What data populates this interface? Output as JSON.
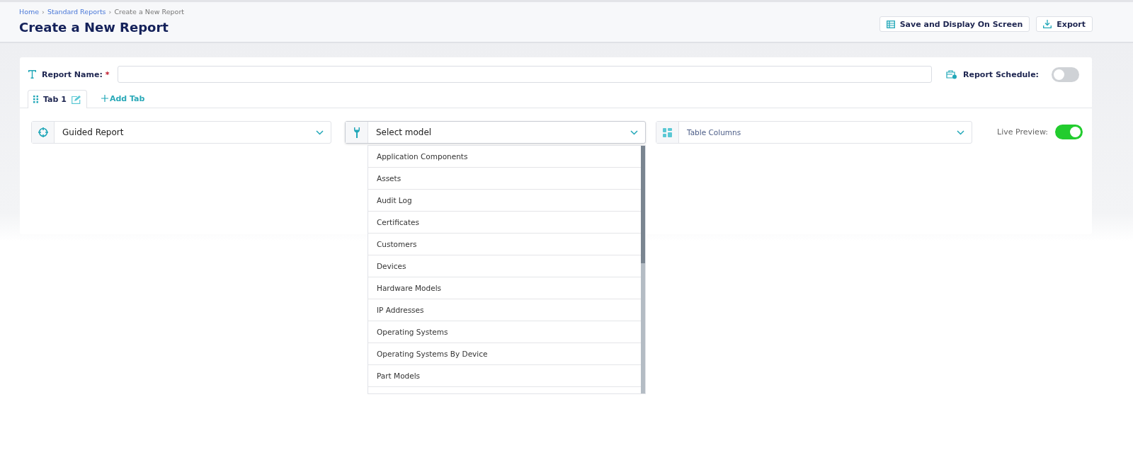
{
  "breadcrumb": [
    {
      "label": "Home",
      "link": true
    },
    {
      "label": "Standard Reports",
      "link": true
    },
    {
      "label": "Create a New Report",
      "link": false
    }
  ],
  "breadcrumb_separator": "›",
  "title": "Create a New Report",
  "actions": [
    {
      "label": "Save and Display On Screen",
      "kind": "table"
    },
    {
      "label": "Export",
      "kind": "download"
    }
  ],
  "report_name": {
    "label": "Report Name:",
    "required": "*"
  },
  "report_schedule": {
    "label": "Report Schedule:",
    "on": false
  },
  "tabs": [
    {
      "label": "Tab 1",
      "selected": true
    }
  ],
  "add_tab": "Add Tab",
  "selects": [
    {
      "value": "Guided Report",
      "kind": "target"
    },
    {
      "value": "Select model",
      "kind": "wrench",
      "open": true
    },
    {
      "value": "Table Columns",
      "kind": "layout"
    }
  ],
  "live_preview": {
    "label": "Live Preview:",
    "on": true
  },
  "model_options": [
    "Application Components",
    "Assets",
    "Audit Log",
    "Certificates",
    "Customers",
    "Devices",
    "Hardware Models",
    "IP Addresses",
    "Operating Systems",
    "Operating Systems By Device",
    "Part Models"
  ]
}
